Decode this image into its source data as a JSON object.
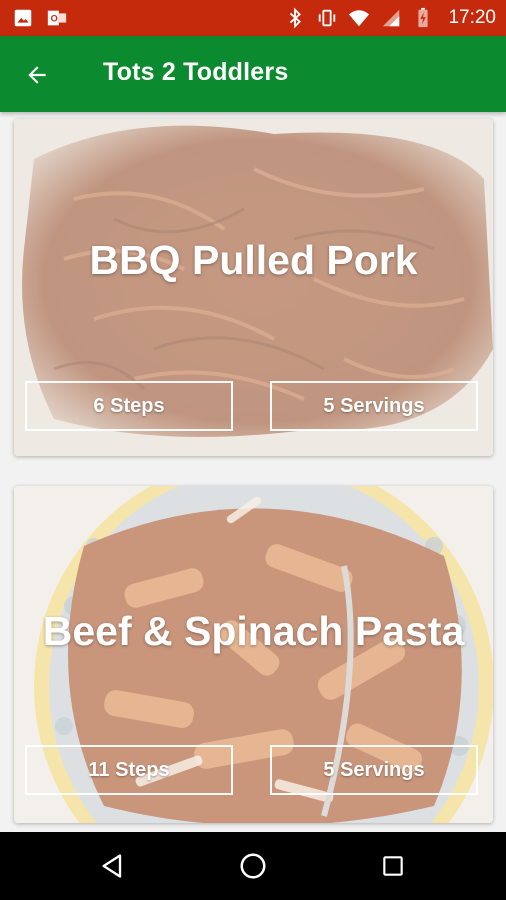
{
  "status_bar": {
    "time": "17:20",
    "background_color": "#c62a0d",
    "icons_left": [
      "image-icon",
      "outlook-icon"
    ],
    "icons_right": [
      "bluetooth-icon",
      "vibrate-icon",
      "wifi-icon",
      "signal-icon",
      "battery-charging-icon"
    ]
  },
  "app_bar": {
    "title": "Tots 2 Toddlers",
    "background_color": "#0b8a2f",
    "back_icon": "arrow-back-icon"
  },
  "recipes": [
    {
      "title": "BBQ Pulled Pork",
      "steps": "6 Steps",
      "servings": "5 Servings"
    },
    {
      "title": "Beef & Spinach Pasta",
      "steps": "11 Steps",
      "servings": "5 Servings"
    }
  ],
  "nav_bar": {
    "icons": [
      "nav-back-icon",
      "nav-home-icon",
      "nav-recents-icon"
    ]
  }
}
